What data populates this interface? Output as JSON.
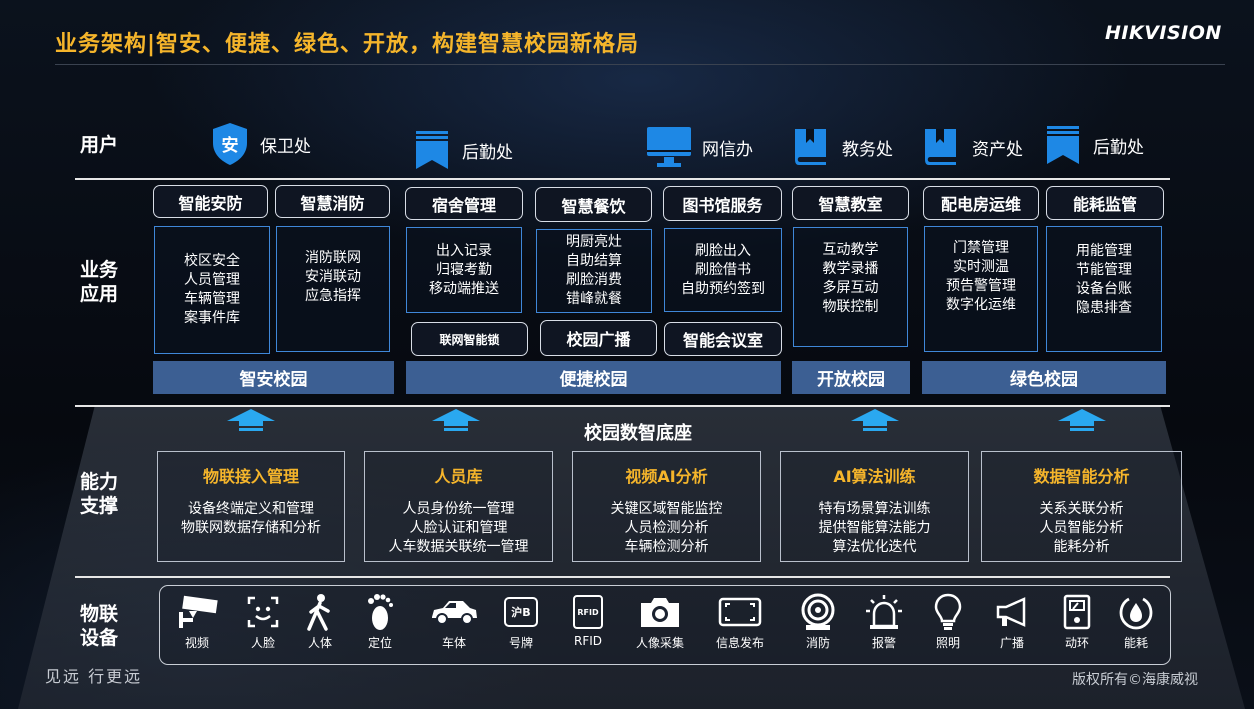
{
  "header": {
    "title": "业务架构|智安、便捷、绿色、开放，构建智慧校园新格局",
    "logo": "HIKVISION"
  },
  "rows": {
    "users": "用户",
    "business": "业务\n应用",
    "support": "能力\n支撑",
    "devices": "物联\n设备"
  },
  "users": [
    {
      "label": "保卫处",
      "icon": "shield-icon"
    },
    {
      "label": "后勤处",
      "icon": "bookmark-icon"
    },
    {
      "label": "网信办",
      "icon": "monitor-icon"
    },
    {
      "label": "教务处",
      "icon": "book-icon"
    },
    {
      "label": "资产处",
      "icon": "book-icon"
    },
    {
      "label": "后勤处",
      "icon": "bookmark-icon"
    }
  ],
  "shield_glyph": "安",
  "apps": [
    {
      "title": "智能安防",
      "items": [
        "校区安全",
        "人员管理",
        "车辆管理",
        "案事件库"
      ]
    },
    {
      "title": "智慧消防",
      "items": [
        "消防联网",
        "安消联动",
        "应急指挥"
      ]
    },
    {
      "title": "宿舍管理",
      "items": [
        "出入记录",
        "归寝考勤",
        "移动端推送"
      ]
    },
    {
      "title": "智慧餐饮",
      "items": [
        "明厨亮灶",
        "自助结算",
        "刷脸消费",
        "错峰就餐"
      ]
    },
    {
      "title": "图书馆服务",
      "items": [
        "刷脸出入",
        "刷脸借书",
        "自助预约签到"
      ]
    },
    {
      "title": "智慧教室",
      "items": [
        "互动教学",
        "教学录播",
        "多屏互动",
        "物联控制"
      ]
    },
    {
      "title": "配电房运维",
      "items": [
        "门禁管理",
        "实时测温",
        "预告警管理",
        "数字化运维"
      ]
    },
    {
      "title": "能耗监管",
      "items": [
        "用能管理",
        "节能管理",
        "设备台账",
        "隐患排查"
      ]
    }
  ],
  "extra_tags": [
    "联网智能锁",
    "校园广播",
    "智能会议室"
  ],
  "campus_bars": [
    "智安校园",
    "便捷校园",
    "开放校园",
    "绿色校园"
  ],
  "platform": {
    "title": "校园数智底座"
  },
  "capabilities": [
    {
      "title": "物联接入管理",
      "items": [
        "设备终端定义和管理",
        "物联网数据存储和分析"
      ]
    },
    {
      "title": "人员库",
      "items": [
        "人员身份统一管理",
        "人脸认证和管理",
        "人车数据关联统一管理"
      ]
    },
    {
      "title": "视频AI分析",
      "items": [
        "关键区域智能监控",
        "人员检测分析",
        "车辆检测分析"
      ]
    },
    {
      "title": "AI算法训练",
      "items": [
        "特有场景算法训练",
        "提供智能算法能力",
        "算法优化迭代"
      ]
    },
    {
      "title": "数据智能分析",
      "items": [
        "关系关联分析",
        "人员智能分析",
        "能耗分析"
      ]
    }
  ],
  "devices": [
    {
      "label": "视频",
      "icon": "camera-icon"
    },
    {
      "label": "人脸",
      "icon": "face-icon"
    },
    {
      "label": "人体",
      "icon": "walker-icon"
    },
    {
      "label": "定位",
      "icon": "footprint-icon"
    },
    {
      "label": "车体",
      "icon": "car-icon"
    },
    {
      "label": "号牌",
      "icon": "plate-icon",
      "glyph": "沪B"
    },
    {
      "label": "RFID",
      "icon": "rfid-icon",
      "glyph": "RFID"
    },
    {
      "label": "人像采集",
      "icon": "photo-camera-icon"
    },
    {
      "label": "信息发布",
      "icon": "screen-icon"
    },
    {
      "label": "消防",
      "icon": "hose-icon"
    },
    {
      "label": "报警",
      "icon": "alarm-icon"
    },
    {
      "label": "照明",
      "icon": "bulb-icon"
    },
    {
      "label": "广播",
      "icon": "speaker-icon"
    },
    {
      "label": "动环",
      "icon": "meter-icon"
    },
    {
      "label": "能耗",
      "icon": "energy-icon"
    }
  ],
  "footer": {
    "slogan": "见远 行更远",
    "copyright": "版权所有©海康威视"
  },
  "colors": {
    "accent": "#f5b52b",
    "blue": "#1e88e5",
    "bar": "#3c5f93",
    "box_border": "#3f87d8"
  }
}
